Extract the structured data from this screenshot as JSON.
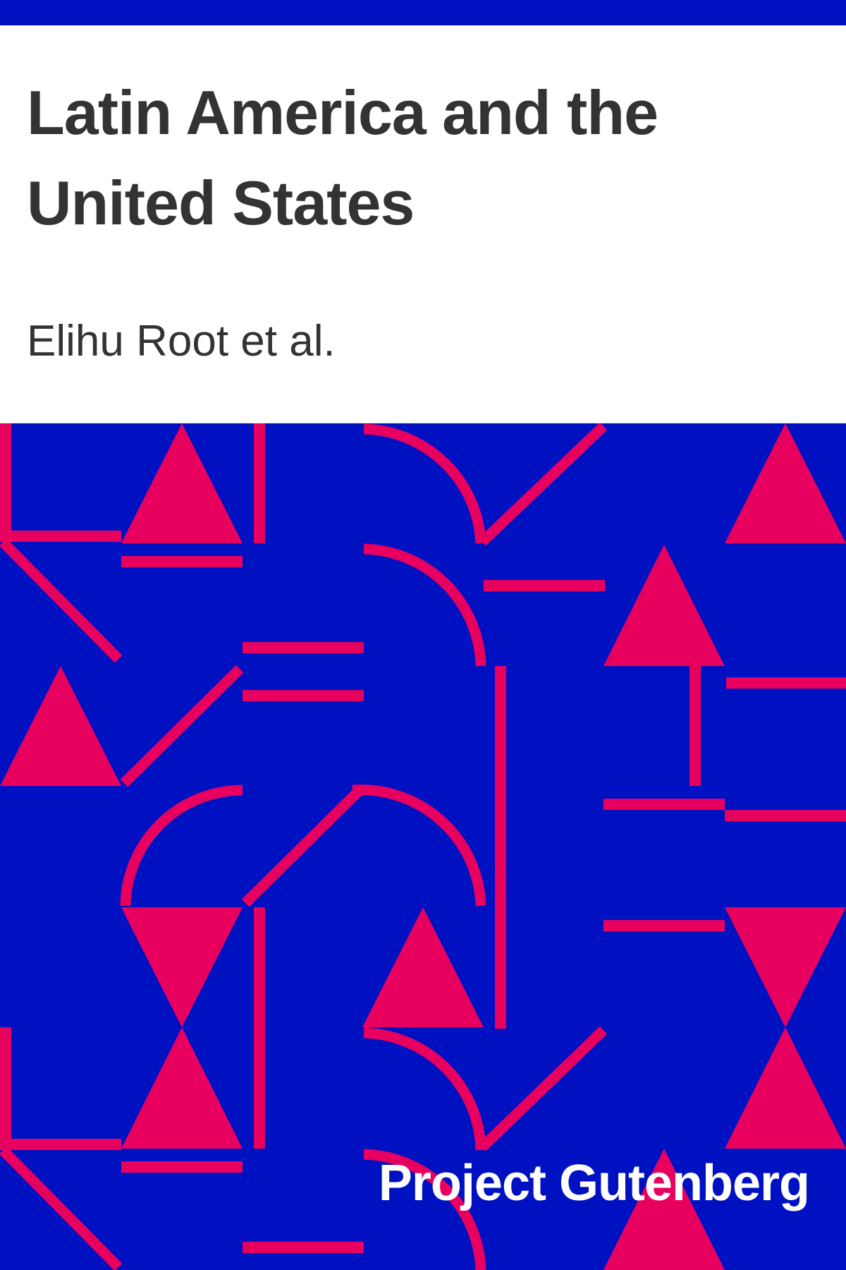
{
  "cover": {
    "title": "Latin America and the United States",
    "author": "Elihu Root et al.",
    "publisher": "Project Gutenberg"
  },
  "colors": {
    "background": "#0011c2",
    "pattern": "#e8005f",
    "title_text": "#333333",
    "publisher_text": "#ffffff"
  }
}
